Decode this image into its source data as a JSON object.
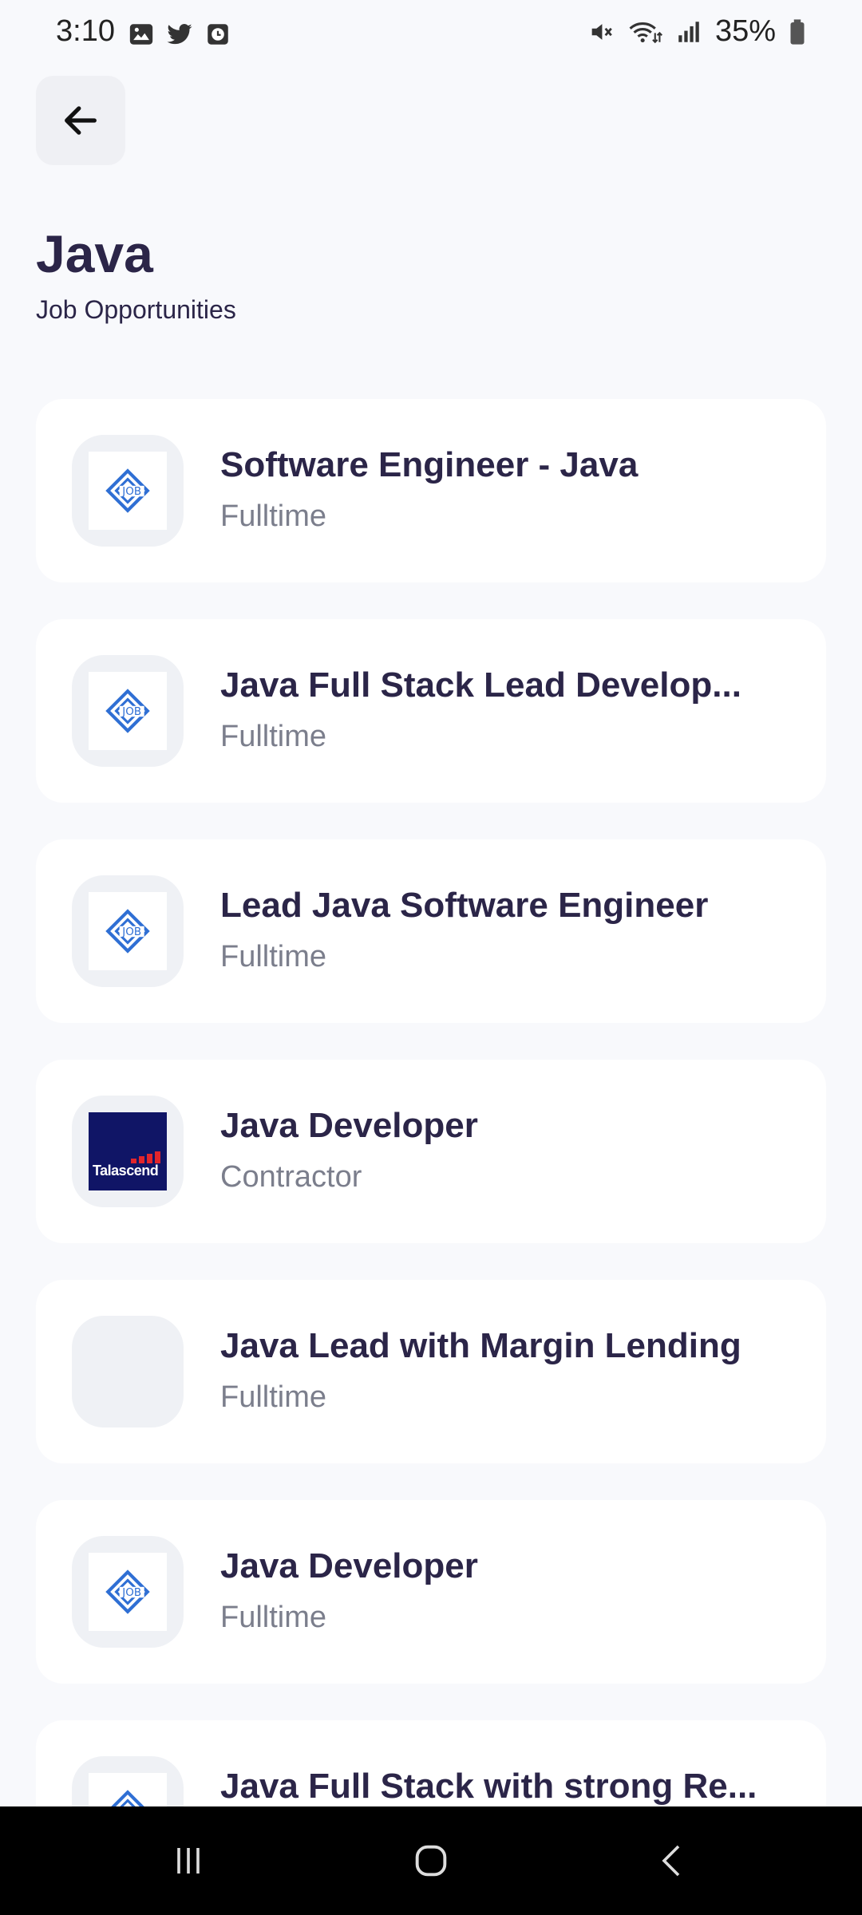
{
  "status_bar": {
    "time": "3:10",
    "battery": "35%",
    "left_icons": [
      "gallery-icon",
      "twitter-icon",
      "clock-app-icon"
    ],
    "right_icons": [
      "mute-icon",
      "wifi-icon",
      "signal-icon",
      "battery-icon"
    ]
  },
  "header": {
    "title": "Java",
    "subtitle": "Job Opportunities"
  },
  "jobs": [
    {
      "title": "Software Engineer - Java",
      "type": "Fulltime",
      "logo": "job-logo"
    },
    {
      "title": "Java Full Stack Lead Develop...",
      "type": "Fulltime",
      "logo": "job-logo"
    },
    {
      "title": "Lead Java Software Engineer",
      "type": "Fulltime",
      "logo": "job-logo"
    },
    {
      "title": "Java Developer",
      "type": "Contractor",
      "logo": "talascend-logo",
      "logo_text": "Talascend"
    },
    {
      "title": "Java Lead with Margin Lending",
      "type": "Fulltime",
      "logo": "none"
    },
    {
      "title": "Java Developer",
      "type": "Fulltime",
      "logo": "job-logo"
    },
    {
      "title": "Java Full Stack with strong Re...",
      "type": "",
      "logo": "job-logo"
    }
  ],
  "colors": {
    "background": "#f8f9fc",
    "card": "#ffffff",
    "title": "#2b2548",
    "subtext": "#7b7e8c",
    "logo_blue": "#2f6fd4",
    "nav_bar": "#000000"
  },
  "nav_bar": [
    "recent-apps-icon",
    "home-icon",
    "back-icon"
  ]
}
